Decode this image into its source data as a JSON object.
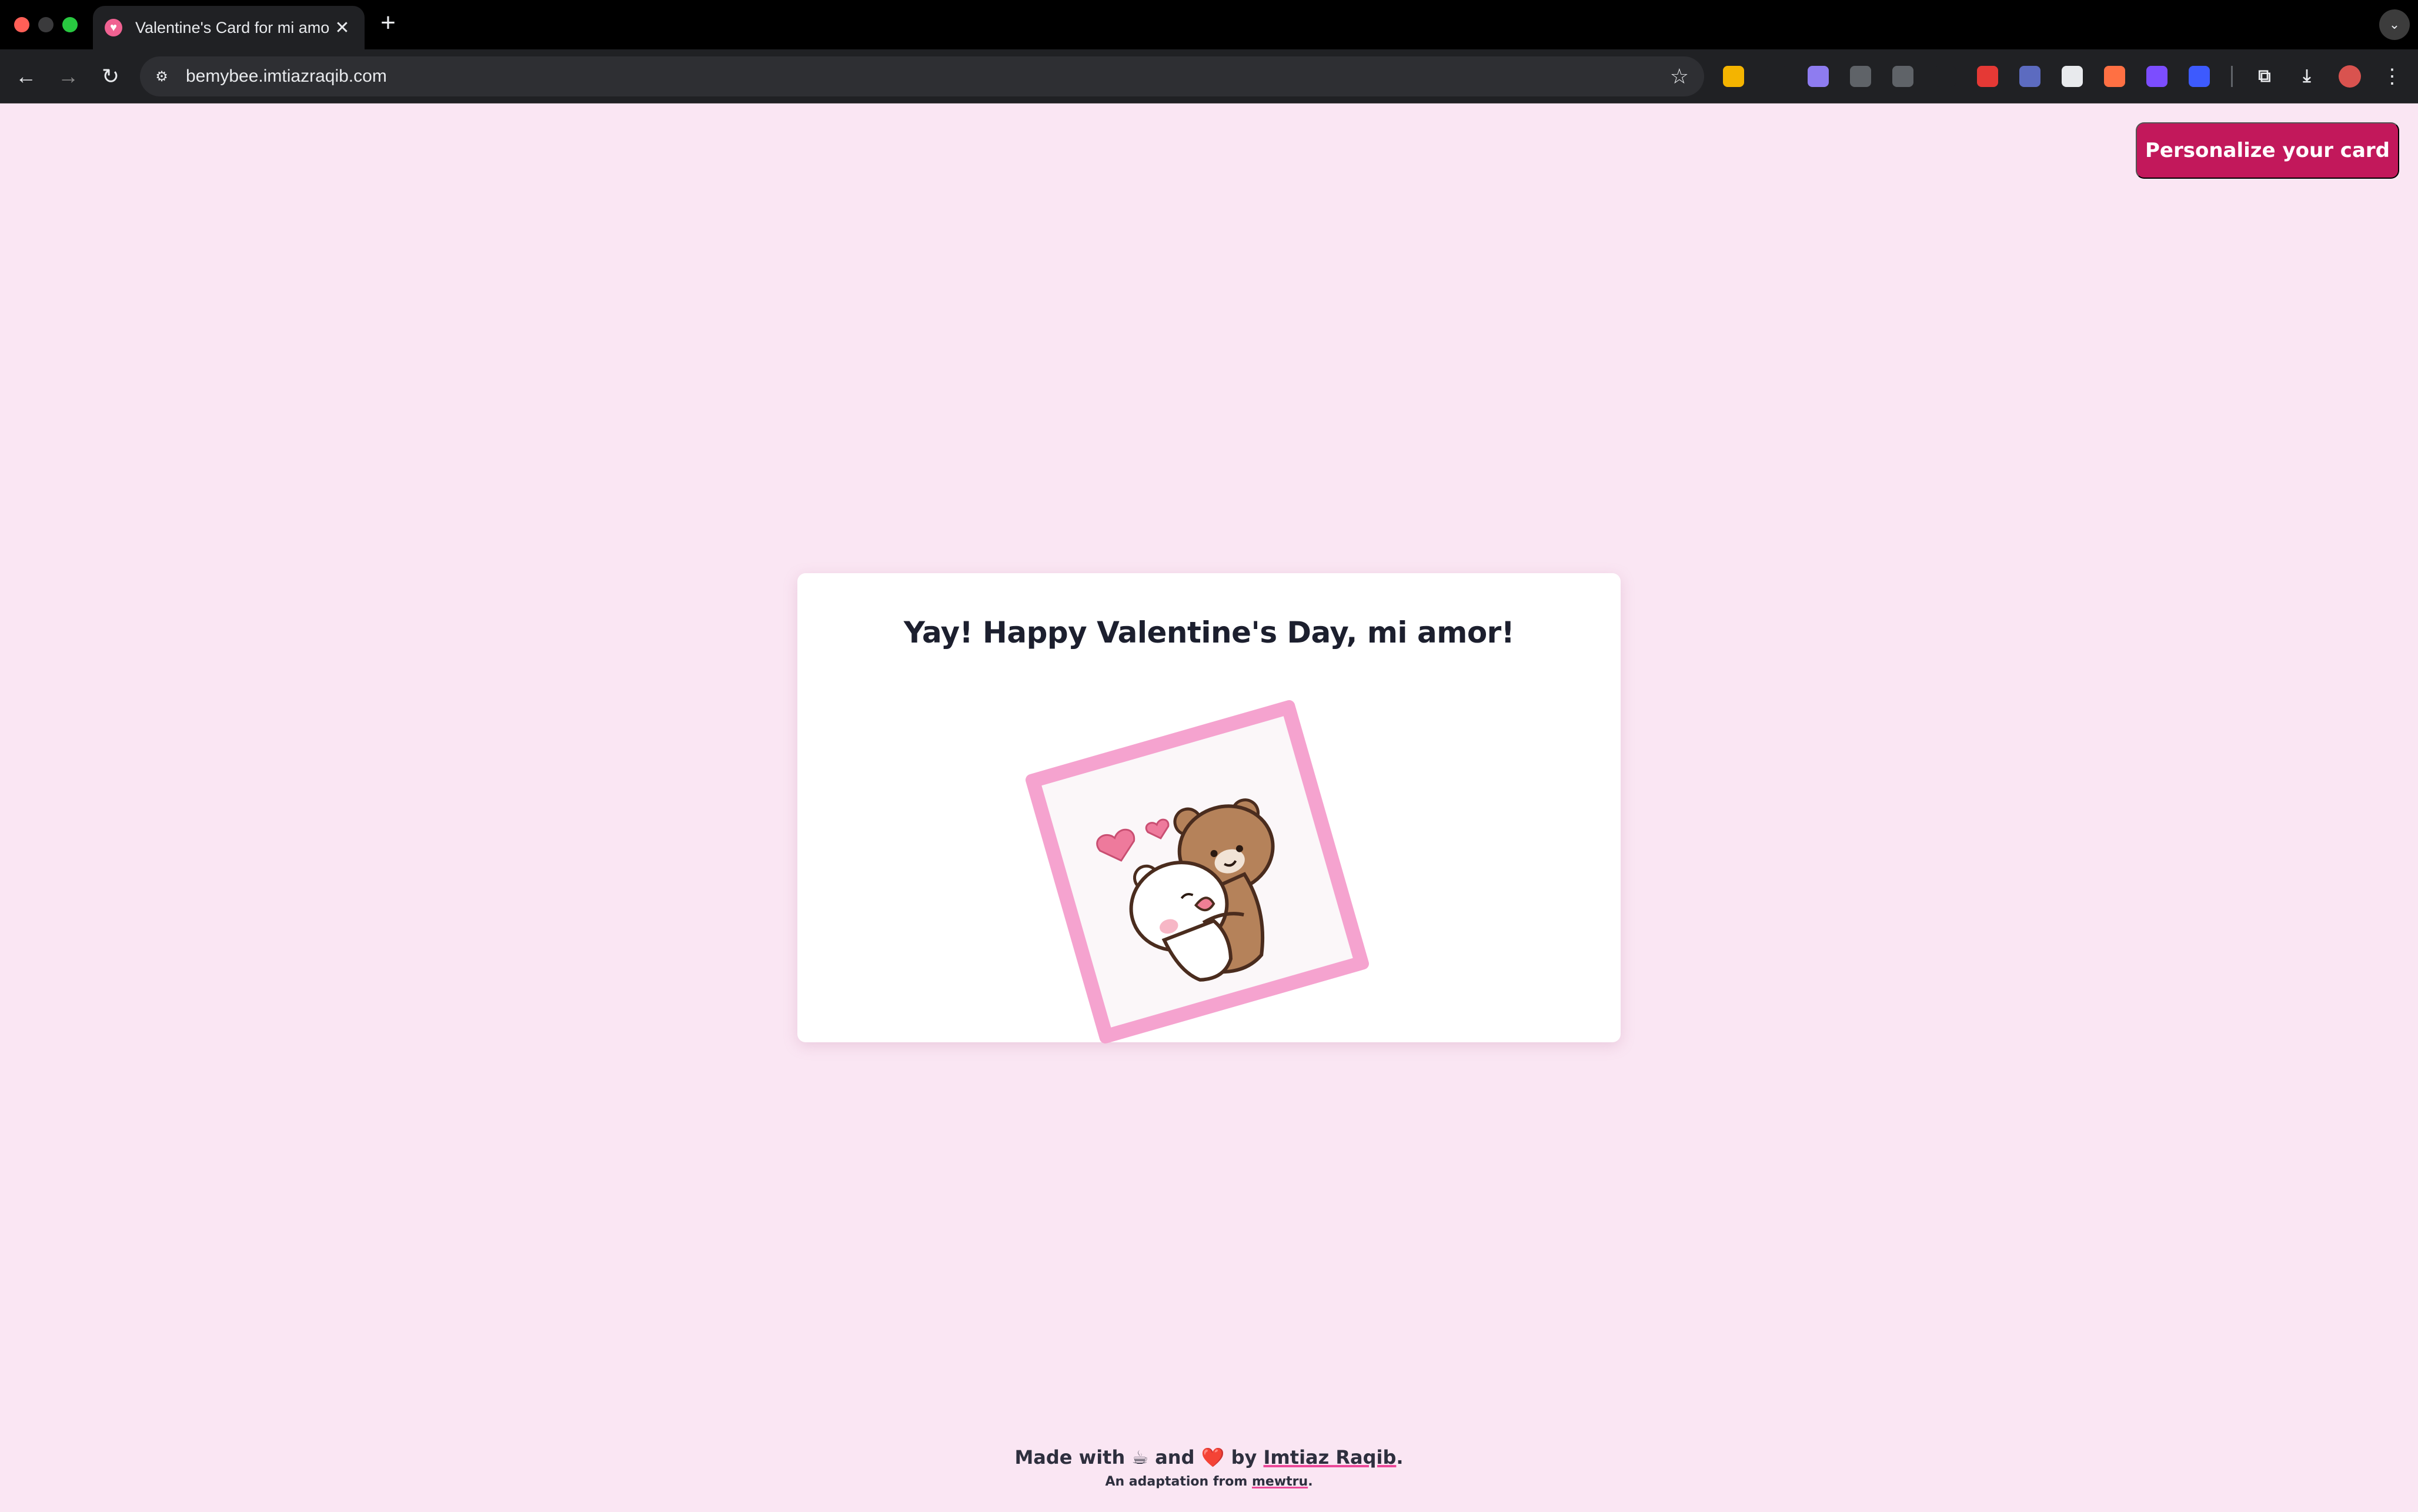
{
  "browser": {
    "tab_title": "Valentine's Card for mi amor",
    "url": "bemybee.imtiazraqib.com",
    "extensions": [
      {
        "name": "ext-1",
        "color": "#f4b400"
      },
      {
        "name": "ext-2",
        "color": "#202124"
      },
      {
        "name": "ext-3",
        "color": "#8e7cf0"
      },
      {
        "name": "ext-4",
        "color": "#5f6368"
      },
      {
        "name": "ext-5",
        "color": "#5f6368"
      },
      {
        "name": "ext-6",
        "color": "#202124"
      },
      {
        "name": "ext-7",
        "color": "#e53935"
      },
      {
        "name": "ext-8",
        "color": "#5c6bc0"
      },
      {
        "name": "ext-9",
        "color": "#e8eaed"
      },
      {
        "name": "ext-10",
        "color": "#ff7043"
      },
      {
        "name": "ext-11",
        "color": "#7c4dff"
      },
      {
        "name": "ext-12",
        "color": "#3d5afe"
      }
    ]
  },
  "page": {
    "personalize_label": "Personalize your card",
    "card_title": "Yay! Happy Valentine's Day, mi amor!",
    "footer": {
      "made_with": "Made with",
      "coffee": "☕",
      "and": "and",
      "heart": "❤️",
      "by": "by",
      "author": "Imtiaz Raqib",
      "period": ".",
      "adaptation": "An adaptation from",
      "source": "mewtru",
      "source_period": "."
    }
  },
  "colors": {
    "page_bg": "#fae6f3",
    "accent": "#c2185b",
    "frame": "#f5a3cf"
  }
}
